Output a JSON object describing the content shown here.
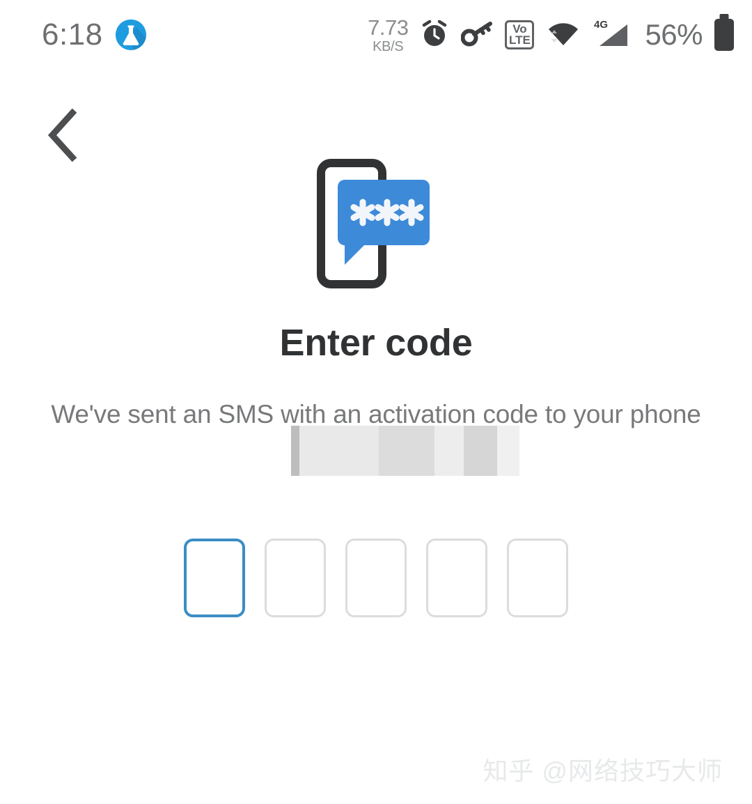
{
  "status_bar": {
    "time": "6:18",
    "app_badge_icon": "flask-icon",
    "network_speed_value": "7.73",
    "network_speed_unit": "KB/S",
    "alarm_icon": "alarm-clock-icon",
    "vpn_icon": "key-icon",
    "volte_top": "Vo",
    "volte_bottom": "LTE",
    "wifi_icon": "wifi-icon",
    "signal_label": "4G",
    "battery_percent": "56%",
    "battery_icon": "battery-icon"
  },
  "nav": {
    "back_icon": "chevron-left-icon",
    "back_label": "Back"
  },
  "illustration": {
    "name": "sms-code-illustration",
    "phone_icon": "phone-outline-icon",
    "bubble_icon": "speech-bubble-icon",
    "bubble_text": "✱✱✱",
    "phone_stroke_color": "#303234",
    "bubble_color": "#3d8ad8"
  },
  "main": {
    "title": "Enter code",
    "description": "We've sent an SMS with an activation code to your phone",
    "phone_number_prefix": "+86",
    "phone_number_redacted": true
  },
  "code_input": {
    "length": 5,
    "focused_index": 0,
    "focus_color": "#3b8dc4",
    "idle_color": "#dcdcdc",
    "cells": [
      "",
      "",
      "",
      "",
      ""
    ]
  },
  "watermark": {
    "text": "知乎 @网络技巧大师"
  }
}
